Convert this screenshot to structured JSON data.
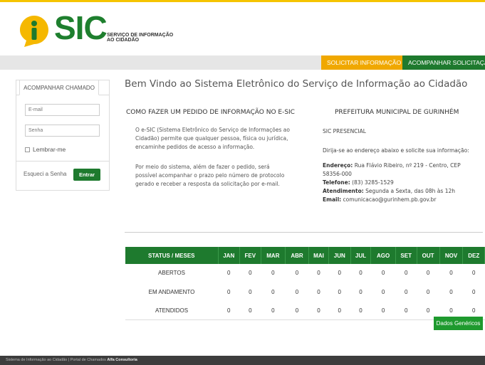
{
  "colors": {
    "brand_green": "#1e7a2e",
    "accent_yellow": "#f0a800",
    "top_line": "#f5c400",
    "footer_bg": "#3d3d3d"
  },
  "header": {
    "logo_text": "SIC",
    "logo_sub_line1": "SERVIÇO DE INFORMAÇÃO",
    "logo_sub_line2": "AO CIDADÃO"
  },
  "nav": {
    "solicitar": "SOLICITAR INFORMAÇÃO",
    "acompanhar": "ACOMPANHAR SOLICITAÇÃO"
  },
  "login": {
    "tab_label": "ACOMPANHAR CHAMADO",
    "email_placeholder": "E-mail",
    "senha_placeholder": "Senha",
    "remember_label": "Lembrar-me",
    "forgot_label": "Esqueci a Senha",
    "entrar_label": "Entrar"
  },
  "main": {
    "welcome": "Bem Vindo ao Sistema Eletrônico do Serviço de Informação ao Cidadão",
    "como_title": "COMO FAZER UM PEDIDO DE INFORMAÇÃO NO E-SIC",
    "como_p1": "O e-SIC (Sistema Eletrônico do Serviço de Informações ao Cidadão) permite que qualquer pessoa, física ou jurídica, encaminhe pedidos de acesso a informação.",
    "como_p2": "Por meio do sistema, além de fazer o pedido, será possível acompanhar o prazo pelo número de protocolo gerado e receber a resposta da solicitação por e-mail.",
    "pref_title": "PREFEITURA MUNICIPAL DE GURINHÉM",
    "presencial": "SIC PRESENCIAL",
    "dirija": "Dirija-se ao endereço abaixo e solicite sua informação:",
    "endereco_label": "Endereço:",
    "endereco_value": "Rua Flávio Ribeiro, nº 219 - Centro, CEP 58356-000",
    "telefone_label": "Telefone:",
    "telefone_value": "(83) 3285-1529",
    "atendimento_label": "Atendimento:",
    "atendimento_value": "Segunda a Sexta, das 08h às 12h",
    "email_label": "Email:",
    "email_value": "comunicacao@gurinhem.pb.gov.br"
  },
  "stats": {
    "header_status": "STATUS / MESES",
    "months": [
      "JAN",
      "FEV",
      "MAR",
      "ABR",
      "MAI",
      "JUN",
      "JUL",
      "AGO",
      "SET",
      "OUT",
      "NOV",
      "DEZ"
    ],
    "rows": [
      {
        "label": "ABERTOS",
        "values": [
          "0",
          "0",
          "0",
          "0",
          "0",
          "0",
          "0",
          "0",
          "0",
          "0",
          "0",
          "0"
        ]
      },
      {
        "label": "EM ANDAMENTO",
        "values": [
          "0",
          "0",
          "0",
          "0",
          "0",
          "0",
          "0",
          "0",
          "0",
          "0",
          "0",
          "0"
        ]
      },
      {
        "label": "ATENDIDOS",
        "values": [
          "0",
          "0",
          "0",
          "0",
          "0",
          "0",
          "0",
          "0",
          "0",
          "0",
          "0",
          "0"
        ]
      }
    ]
  },
  "dados_button": "Dados Genéricos",
  "footer": {
    "text": "Sistema de Informação ao Cidadão | Portal de Chamados ",
    "brand": "Alfa Consultoria"
  }
}
